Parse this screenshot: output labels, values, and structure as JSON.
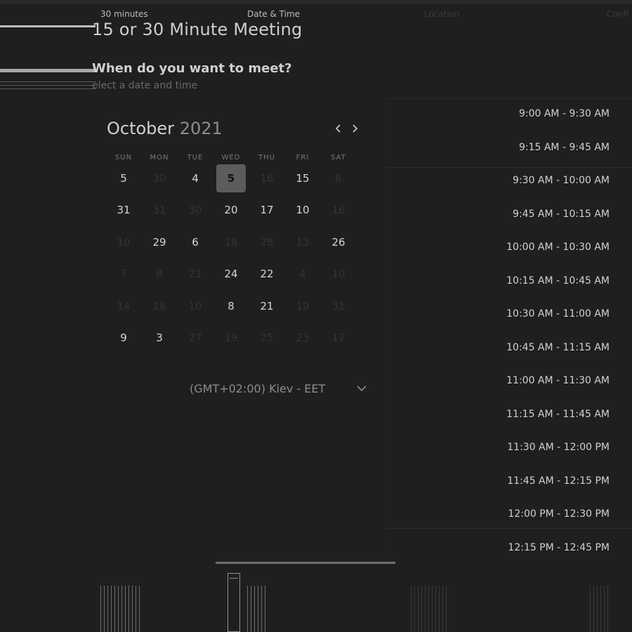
{
  "meeting": {
    "title": "15 or 30 Minute Meeting",
    "question": "When do you want to meet?",
    "subtitle": "elect a date and time"
  },
  "calendar": {
    "month": "October",
    "year": "2021",
    "prev_icon": "chevron-left-icon",
    "next_icon": "chevron-right-icon",
    "weekdays": [
      "SUN",
      "MON",
      "TUE",
      "WED",
      "THU",
      "FRI",
      "SAT"
    ],
    "days": [
      [
        "5",
        "30",
        "4",
        "5",
        "16",
        "15",
        "6"
      ],
      [
        "31",
        "31",
        "30",
        "20",
        "17",
        "10",
        "16"
      ],
      [
        "10",
        "29",
        "6",
        "18",
        "28",
        "13",
        "26"
      ],
      [
        "7",
        "8",
        "21",
        "24",
        "22",
        "4",
        "10"
      ],
      [
        "14",
        "18",
        "10",
        "8",
        "21",
        "19",
        "31"
      ],
      [
        "9",
        "3",
        "27",
        "19",
        "25",
        "23",
        "17"
      ]
    ],
    "enabled": [
      [
        true,
        false,
        true,
        true,
        false,
        true,
        false
      ],
      [
        true,
        false,
        false,
        true,
        true,
        true,
        false
      ],
      [
        false,
        true,
        true,
        false,
        false,
        false,
        true
      ],
      [
        false,
        false,
        false,
        true,
        true,
        false,
        false
      ],
      [
        false,
        false,
        false,
        true,
        true,
        false,
        false
      ],
      [
        true,
        true,
        false,
        false,
        false,
        false,
        false
      ]
    ],
    "selected": {
      "row": 0,
      "col": 3
    }
  },
  "timezone": {
    "label": "(GMT+02:00) Kiev - EET",
    "dropdown_icon": "chevron-down-icon"
  },
  "time_slots": [
    "9:00 AM - 9:30 AM",
    "9:15 AM - 9:45 AM",
    "9:30 AM - 10:00 AM",
    "9:45 AM - 10:15 AM",
    "10:00 AM - 10:30 AM",
    "10:15 AM - 10:45 AM",
    "10:30 AM - 11:00 AM",
    "10:45 AM - 11:15 AM",
    "11:00 AM - 11:30 AM",
    "11:15 AM - 11:45 AM",
    "11:30 AM - 12:00 PM",
    "11:45 AM - 12:15 PM",
    "12:00 PM - 12:30 PM",
    "12:15 PM - 12:45 PM"
  ],
  "footer": {
    "tabs": [
      {
        "label": "30 minutes",
        "active": false
      },
      {
        "label": "Date & Time",
        "active": true
      },
      {
        "label": "Location",
        "active": false
      },
      {
        "label": "Confi",
        "active": false
      }
    ]
  }
}
